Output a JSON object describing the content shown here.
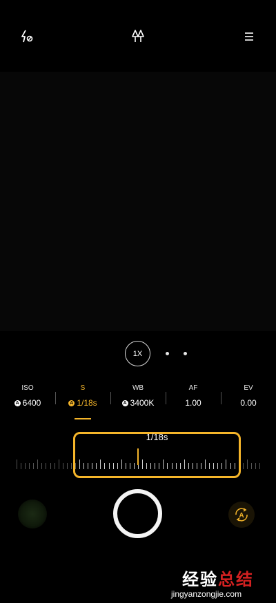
{
  "top_bar": {
    "flash_icon": "flash-off-icon",
    "macro_icon": "macro-icon",
    "menu_icon": "menu-icon"
  },
  "zoom": {
    "level_label": "1X"
  },
  "params": [
    {
      "label": "ISO",
      "value": "6400",
      "auto": true,
      "active": false
    },
    {
      "label": "S",
      "value": "1/18s",
      "auto": true,
      "active": true
    },
    {
      "label": "WB",
      "value": "3400K",
      "auto": true,
      "active": false
    },
    {
      "label": "AF",
      "value": "1.00",
      "auto": false,
      "active": false
    },
    {
      "label": "EV",
      "value": "0.00",
      "auto": false,
      "active": false
    }
  ],
  "dial": {
    "readout": "1/18s"
  },
  "auto_badge_letter": "A",
  "auto_mode_icon": "auto-mode-icon",
  "colors": {
    "accent": "#f5b52a",
    "background": "#000000"
  },
  "watermark": {
    "title_part1": "经验",
    "title_part2": "总结",
    "url": "jingyanzongjie.com"
  }
}
